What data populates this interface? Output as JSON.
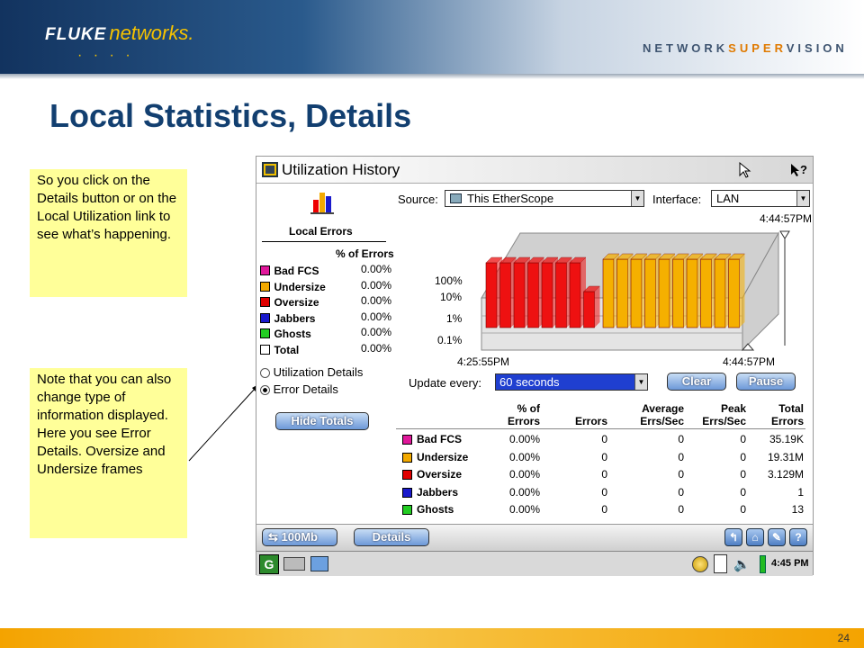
{
  "header": {
    "logo_fluke": "FLUKE",
    "logo_networks": "networks.",
    "logo_dots": "· · · ·",
    "tagline_a": "NETWORK",
    "tagline_b": "SUPER",
    "tagline_c": "VISION"
  },
  "slide": {
    "title": "Local Statistics, Details",
    "page_number": "24"
  },
  "notes": {
    "note1": "So you click on the Details button or on the Local Utilization link to see what’s happening.",
    "note2": "Note that you can also change type of information displayed.  Here you see Error Details.  Oversize and Undersize frames"
  },
  "device": {
    "window_title": "Utilization History",
    "source_label": "Source:",
    "source_value": "This EtherScope",
    "interface_label": "Interface:",
    "interface_value": "LAN",
    "chart_time_top": "4:44:57PM",
    "chart_time_start": "4:25:55PM",
    "chart_time_end": "4:44:57PM",
    "y_ticks": [
      "100%",
      "10%",
      "1%",
      "0.1%"
    ],
    "local_errors_title": "Local Errors",
    "pct_errors_header": "% of Errors",
    "left_rows": [
      {
        "label": "Bad FCS",
        "value": "0.00%",
        "color": "#e0179a"
      },
      {
        "label": "Undersize",
        "value": "0.00%",
        "color": "#f2a900"
      },
      {
        "label": "Oversize",
        "value": "0.00%",
        "color": "#e00000"
      },
      {
        "label": "Jabbers",
        "value": "0.00%",
        "color": "#1a1acc"
      },
      {
        "label": "Ghosts",
        "value": "0.00%",
        "color": "#22cc22"
      },
      {
        "label": "Total",
        "value": "0.00%",
        "color": "#ffffff"
      }
    ],
    "radio_util": "Utilization Details",
    "radio_error": "Error Details",
    "hide_totals": "Hide Totals",
    "update_label": "Update every:",
    "update_value": "60 seconds",
    "clear_btn": "Clear",
    "pause_btn": "Pause",
    "table_headers": [
      "% of\nErrors",
      "Errors",
      "Average\nErrs/Sec",
      "Peak\nErrs/Sec",
      "Total\nErrors"
    ],
    "table_rows": [
      {
        "label": "Bad FCS",
        "color": "#e0179a",
        "cells": [
          "0.00%",
          "0",
          "0",
          "0",
          "35.19K"
        ]
      },
      {
        "label": "Undersize",
        "color": "#f2a900",
        "cells": [
          "0.00%",
          "0",
          "0",
          "0",
          "19.31M"
        ]
      },
      {
        "label": "Oversize",
        "color": "#e00000",
        "cells": [
          "0.00%",
          "0",
          "0",
          "0",
          "3.129M"
        ]
      },
      {
        "label": "Jabbers",
        "color": "#1a1acc",
        "cells": [
          "0.00%",
          "0",
          "0",
          "0",
          "1"
        ]
      },
      {
        "label": "Ghosts",
        "color": "#22cc22",
        "cells": [
          "0.00%",
          "0",
          "0",
          "0",
          "13"
        ]
      }
    ],
    "toolbar_speed": "100Mb",
    "toolbar_details": "Details",
    "clock": "4:45 PM",
    "bar_colors": {
      "red": "#ee1111",
      "orange": "#f5b000"
    }
  }
}
